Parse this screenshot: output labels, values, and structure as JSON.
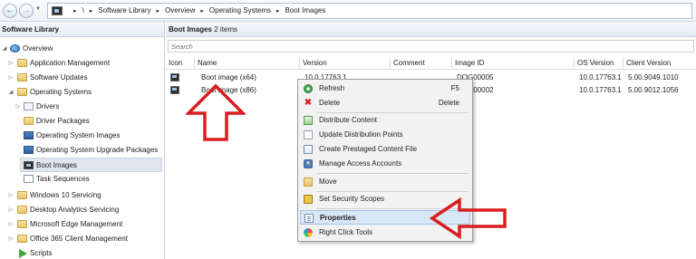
{
  "addressbar": {
    "breadcrumbs": [
      "\\",
      "Software Library",
      "Overview",
      "Operating Systems",
      "Boot Images"
    ]
  },
  "leftpane": {
    "title": "Software Library",
    "items": [
      {
        "label": "Overview",
        "icon": "overview-icon",
        "twisty": "◢"
      },
      {
        "label": "Application Management",
        "icon": "folder-icon",
        "twisty": "▷"
      },
      {
        "label": "Software Updates",
        "icon": "folder-icon",
        "twisty": "▷"
      },
      {
        "label": "Operating Systems",
        "icon": "folder-icon",
        "twisty": "◢"
      },
      {
        "label": "Drivers",
        "icon": "drivers-icon",
        "twisty": "▷"
      },
      {
        "label": "Driver Packages",
        "icon": "folder-icon",
        "twisty": ""
      },
      {
        "label": "Operating System Images",
        "icon": "os-image-icon",
        "twisty": ""
      },
      {
        "label": "Operating System Upgrade Packages",
        "icon": "os-upgrade-icon",
        "twisty": ""
      },
      {
        "label": "Boot Images",
        "icon": "boot-image-icon",
        "twisty": ""
      },
      {
        "label": "Task Sequences",
        "icon": "task-sequence-icon",
        "twisty": ""
      },
      {
        "label": "Windows 10 Servicing",
        "icon": "folder-icon",
        "twisty": "▷"
      },
      {
        "label": "Desktop Analytics Servicing",
        "icon": "folder-icon",
        "twisty": "▷"
      },
      {
        "label": "Microsoft Edge Management",
        "icon": "folder-icon",
        "twisty": "▷"
      },
      {
        "label": "Office 365 Client Management",
        "icon": "folder-icon",
        "twisty": "▷"
      },
      {
        "label": "Scripts",
        "icon": "scripts-icon",
        "twisty": ""
      }
    ]
  },
  "main": {
    "header_title": "Boot Images",
    "header_count": "2 items",
    "search_placeholder": "Search",
    "columns": [
      "Icon",
      "Name",
      "Version",
      "Comment",
      "Image ID",
      "OS Version",
      "Client Version"
    ],
    "rows": [
      {
        "name": "Boot image (x64)",
        "version": "10.0.17763.1",
        "comment": "",
        "image_id": "DOG00005",
        "os_version": "10.0.17763.1",
        "client_version": "5.00.9049.1010"
      },
      {
        "name": "Boot image (x86)",
        "version": "",
        "comment": "",
        "image_id": "DOG00002",
        "os_version": "10.0.17763.1",
        "client_version": "5.00.9012.1056"
      }
    ]
  },
  "context_menu": {
    "items": [
      {
        "label": "Refresh",
        "shortcut": "F5",
        "icon": "refresh-icon"
      },
      {
        "label": "Delete",
        "shortcut": "Delete",
        "icon": "delete-icon"
      },
      {
        "label": "Distribute Content",
        "shortcut": "",
        "icon": "distribute-content-icon"
      },
      {
        "label": "Update Distribution Points",
        "shortcut": "",
        "icon": "update-dp-icon"
      },
      {
        "label": "Create Prestaged Content File",
        "shortcut": "",
        "icon": "prestaged-content-icon"
      },
      {
        "label": "Manage Access Accounts",
        "shortcut": "",
        "icon": "access-accounts-icon"
      },
      {
        "label": "Move",
        "shortcut": "",
        "icon": "move-icon"
      },
      {
        "label": "Set Security Scopes",
        "shortcut": "",
        "icon": "security-scopes-icon"
      },
      {
        "label": "Properties",
        "shortcut": "",
        "icon": "properties-icon"
      },
      {
        "label": "Right Click Tools",
        "shortcut": "",
        "icon": "right-click-tools-icon"
      }
    ],
    "highlighted": "Properties"
  },
  "colors": {
    "accent": "#dfe6ef",
    "menu_highlight": "#d9e6f5",
    "annotation_arrow": "#d81e1e"
  }
}
